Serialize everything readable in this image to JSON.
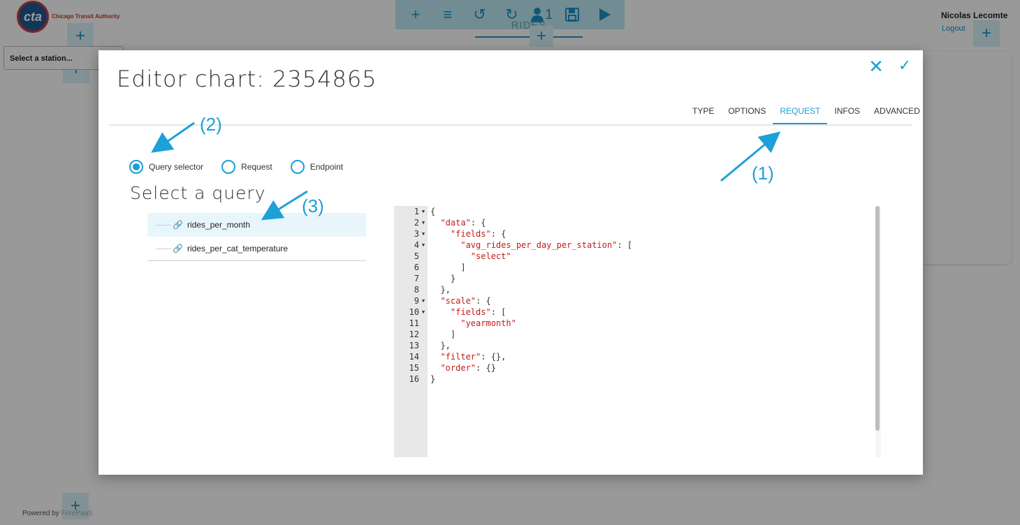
{
  "app": {
    "logo_text": "cta",
    "logo_subtitle": "Chicago Transit Authority",
    "user_name": "Nicolas Lecomte",
    "logout_label": "Logout",
    "dashboard_tab": "RIDES",
    "station_placeholder": "Select a station...",
    "powered_by": "Powered by",
    "powered_brand": "ForePaaS",
    "toolbar": {
      "add_icon": "+",
      "menu_icon": "≡",
      "undo_icon": "↺",
      "redo_icon": "↻",
      "user_count": "1",
      "save_icon": "💾",
      "play_icon": "▶"
    },
    "plus_icon": "+"
  },
  "modal": {
    "title": "Editor chart: 2354865",
    "close_icon": "✕",
    "confirm_icon": "✓",
    "tabs": [
      {
        "label": "TYPE"
      },
      {
        "label": "OPTIONS"
      },
      {
        "label": "REQUEST",
        "active": true
      },
      {
        "label": "INFOS"
      },
      {
        "label": "ADVANCED"
      }
    ],
    "radio_options": [
      {
        "label": "Query selector",
        "checked": true
      },
      {
        "label": "Request",
        "checked": false
      },
      {
        "label": "Endpoint",
        "checked": false
      }
    ],
    "select_query_heading": "Select a query",
    "queries": [
      {
        "name": "rides_per_month",
        "selected": true
      },
      {
        "name": "rides_per_cat_temperature",
        "selected": false
      }
    ],
    "code_lines": [
      {
        "num": "1",
        "fold": true,
        "text": "{"
      },
      {
        "num": "2",
        "fold": true,
        "text": "  \"data\": {"
      },
      {
        "num": "3",
        "fold": true,
        "text": "    \"fields\": {"
      },
      {
        "num": "4",
        "fold": true,
        "text": "      \"avg_rides_per_day_per_station\": ["
      },
      {
        "num": "5",
        "fold": false,
        "text": "        \"select\""
      },
      {
        "num": "6",
        "fold": false,
        "text": "      ]"
      },
      {
        "num": "7",
        "fold": false,
        "text": "    }"
      },
      {
        "num": "8",
        "fold": false,
        "text": "  },"
      },
      {
        "num": "9",
        "fold": true,
        "text": "  \"scale\": {"
      },
      {
        "num": "10",
        "fold": true,
        "text": "    \"fields\": ["
      },
      {
        "num": "11",
        "fold": false,
        "text": "      \"yearmonth\""
      },
      {
        "num": "12",
        "fold": false,
        "text": "    ]"
      },
      {
        "num": "13",
        "fold": false,
        "text": "  },"
      },
      {
        "num": "14",
        "fold": false,
        "text": "  \"filter\": {},"
      },
      {
        "num": "15",
        "fold": false,
        "text": "  \"order\": {}"
      },
      {
        "num": "16",
        "fold": false,
        "text": "}"
      }
    ]
  },
  "annotations": [
    "(1)",
    "(2)",
    "(3)"
  ],
  "colors": {
    "accent": "#1a9fd6",
    "string": "#c41a16",
    "annotation": "#1ea0d8"
  }
}
